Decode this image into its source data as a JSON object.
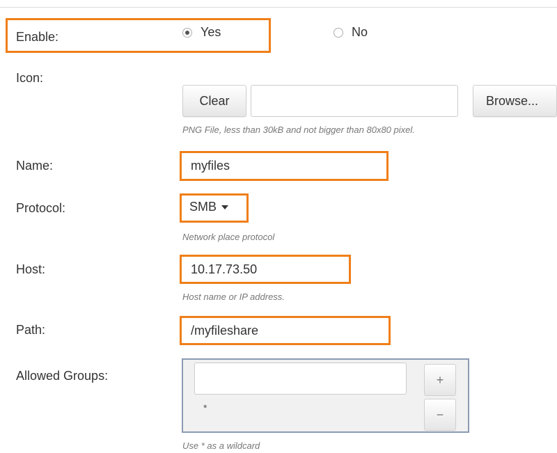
{
  "enable": {
    "label": "Enable:",
    "yes_label": "Yes",
    "no_label": "No",
    "selected": "Yes"
  },
  "icon": {
    "label": "Icon:",
    "clear_label": "Clear",
    "file_value": "",
    "browse_label": "Browse...",
    "hint": "PNG File, less than 30kB and not bigger than 80x80 pixel."
  },
  "name": {
    "label": "Name:",
    "value": "myfiles"
  },
  "protocol": {
    "label": "Protocol:",
    "value": "SMB",
    "hint": "Network place protocol"
  },
  "host": {
    "label": "Host:",
    "value": "10.17.73.50",
    "hint": "Host name or IP address."
  },
  "path": {
    "label": "Path:",
    "value": "/myfileshare"
  },
  "groups": {
    "label": "Allowed Groups:",
    "input_value": "",
    "list_item": "*",
    "add_label": "+",
    "remove_label": "−",
    "hint": "Use * as a wildcard"
  },
  "colors": {
    "highlight": "#f07f19",
    "text": "#333333",
    "hint_text": "#777777"
  }
}
